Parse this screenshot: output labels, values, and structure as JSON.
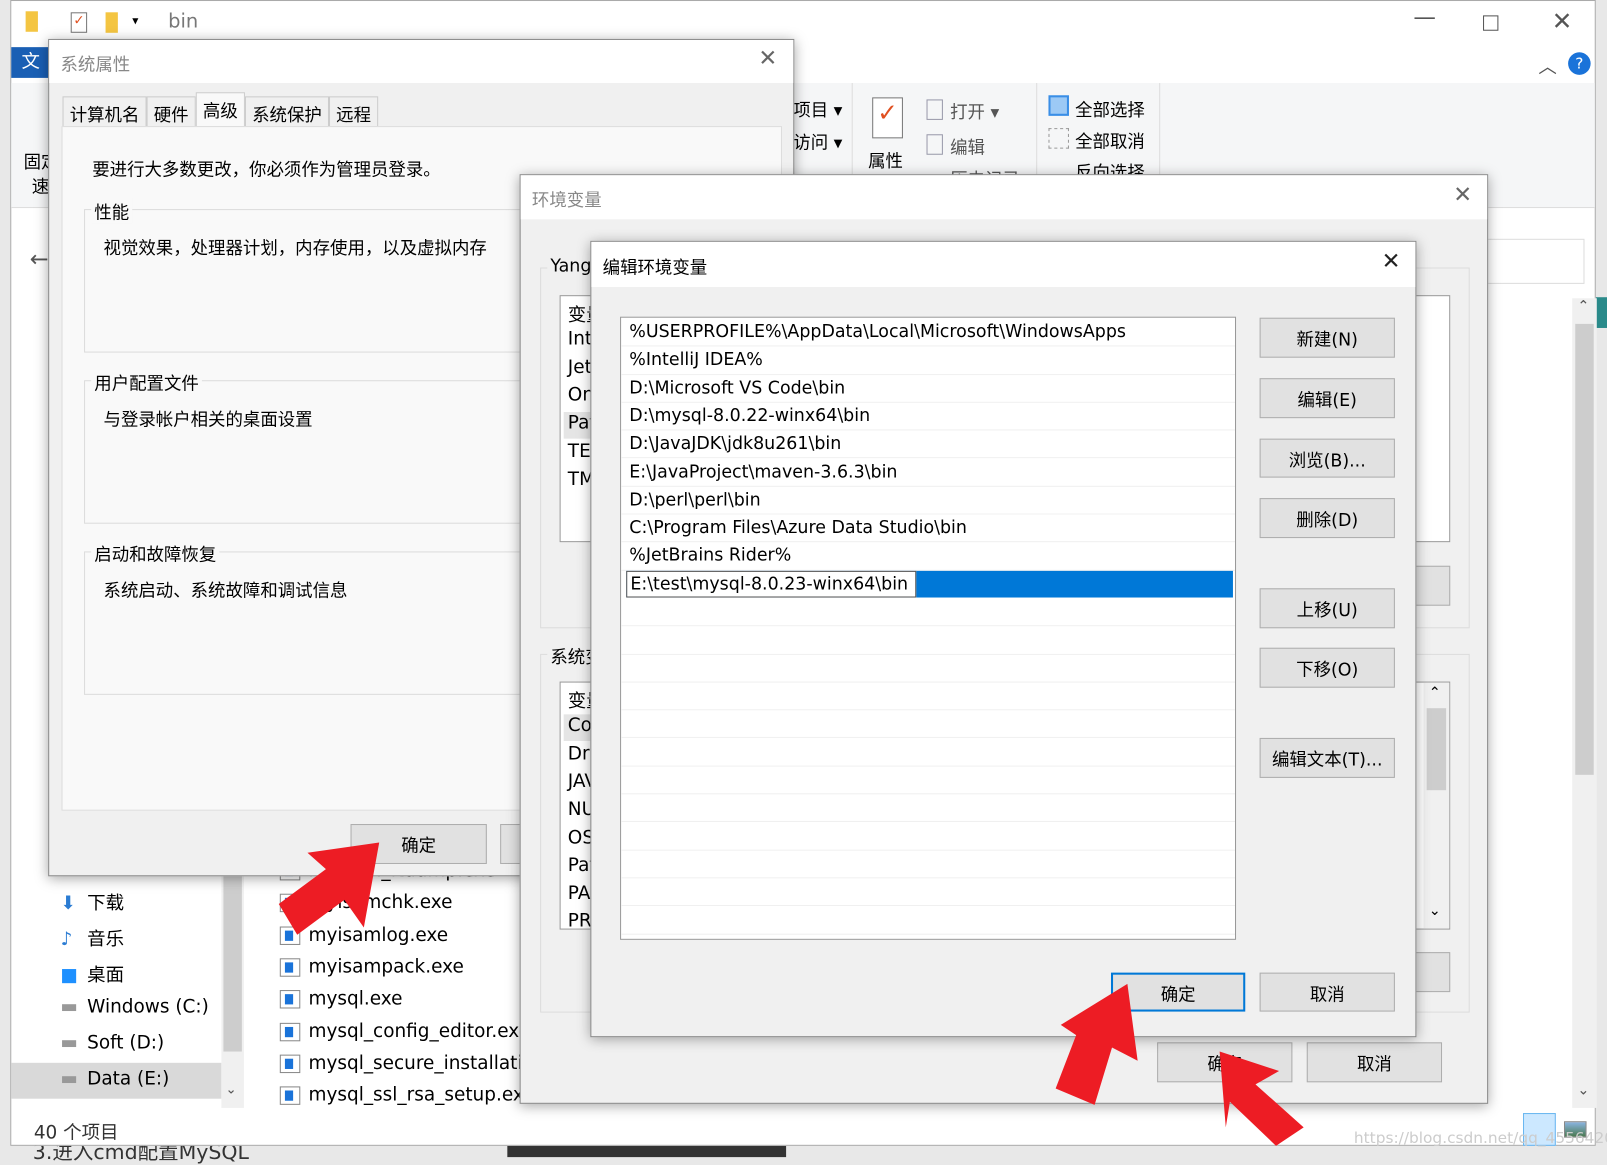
{
  "explorer": {
    "title": "bin",
    "file_tab": "文",
    "ribbon": {
      "item_label": "项目",
      "access_label": "访问",
      "properties": "属性",
      "open": "打开",
      "edit": "编辑",
      "history": "历史记录",
      "select_all": "全部选择",
      "select_none": "全部取消",
      "invert_selection": "反向选择",
      "pin_label_1": "固定",
      "pin_label_2": "速"
    },
    "nav": [
      {
        "label": "下载",
        "icon": "download-icon"
      },
      {
        "label": "音乐",
        "icon": "music-icon"
      },
      {
        "label": "桌面",
        "icon": "desktop-icon"
      },
      {
        "label": "Windows (C:)",
        "icon": "drive-icon"
      },
      {
        "label": "Soft (D:)",
        "icon": "drive-icon"
      },
      {
        "label": "Data (E:)",
        "icon": "drive-icon",
        "selected": true
      }
    ],
    "files": [
      "myisam_ftdump.exe",
      "myisamchk.exe",
      "myisamlog.exe",
      "myisampack.exe",
      "mysql.exe",
      "mysql_config_editor.exe",
      "mysql_secure_installation",
      "mysql_ssl_rsa_setup.exe"
    ],
    "status": "40 个项目"
  },
  "sysprops": {
    "title": "系统属性",
    "tabs": [
      "计算机名",
      "硬件",
      "高级",
      "系统保护",
      "远程"
    ],
    "active_tab": "高级",
    "admin_note": "要进行大多数更改，你必须作为管理员登录。",
    "perf_label": "性能",
    "perf_desc": "视觉效果，处理器计划，内存使用，以及虚拟内存",
    "profile_label": "用户配置文件",
    "profile_desc": "与登录帐户相关的桌面设置",
    "startup_label": "启动和故障恢复",
    "startup_desc": "系统启动、系统故障和调试信息",
    "ok": "确定"
  },
  "envvars": {
    "title": "环境变量",
    "user_group": "Yang",
    "user_vars": [
      "变量",
      "Int",
      "Jet",
      "On",
      "Pat",
      "TEI",
      "TM"
    ],
    "system_group": "系统变",
    "system_vars": [
      "变量",
      "Co",
      "Dri",
      "JAV",
      "NU",
      "OS",
      "Pat",
      "PA",
      "PR"
    ],
    "ok": "确定",
    "cancel": "取消"
  },
  "editdlg": {
    "title": "编辑环境变量",
    "entries": [
      "%USERPROFILE%\\AppData\\Local\\Microsoft\\WindowsApps",
      "%IntelliJ IDEA%",
      "D:\\Microsoft VS Code\\bin",
      "D:\\mysql-8.0.22-winx64\\bin",
      "D:\\JavaJDK\\jdk8u261\\bin",
      "E:\\JavaProject\\maven-3.6.3\\bin",
      "D:\\perl\\perl\\bin",
      "C:\\Program Files\\Azure Data Studio\\bin",
      "%JetBrains Rider%"
    ],
    "editing_value": "E:\\test\\mysql-8.0.23-winx64\\bin",
    "buttons": {
      "new": "新建(N)",
      "edit": "编辑(E)",
      "browse": "浏览(B)...",
      "delete": "删除(D)",
      "up": "上移(U)",
      "down": "下移(O)",
      "edit_text": "编辑文本(T)..."
    },
    "ok": "确定",
    "cancel": "取消"
  },
  "page_below": "3.进入cmd配置MySQL",
  "watermark": "https://blog.csdn.net/qq_45564209",
  "colors": {
    "accent": "#0078d7",
    "arrow": "#ed1c24",
    "dialog_bg": "#f0f0f0"
  }
}
